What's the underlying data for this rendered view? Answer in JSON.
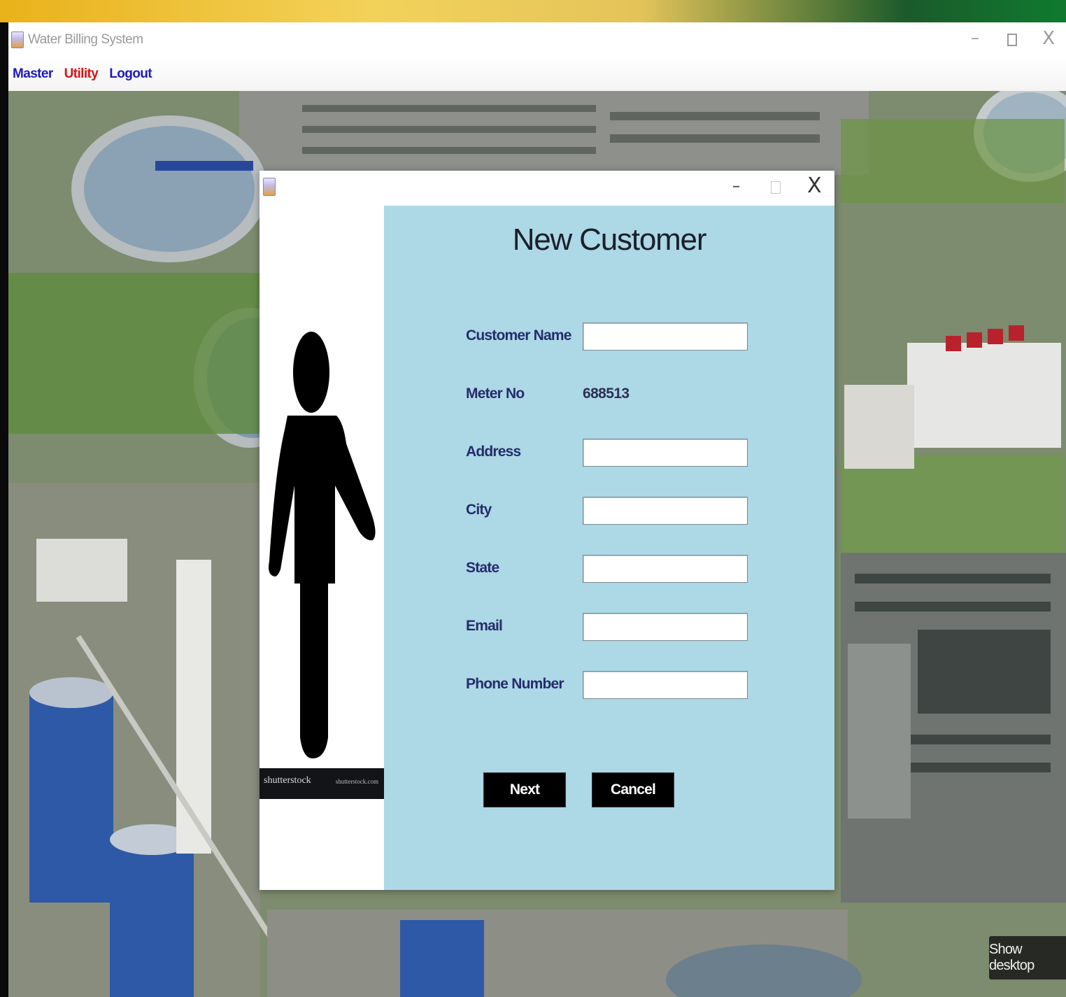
{
  "window": {
    "title": "Water Billing System",
    "controls": {
      "minimize": "–",
      "close": "X"
    }
  },
  "menu": [
    {
      "label": "Master",
      "color": "#1e1ab8"
    },
    {
      "label": "Utility",
      "color": "#d41414"
    },
    {
      "label": "Logout",
      "color": "#1e1ab8"
    }
  ],
  "dialog": {
    "controls": {
      "minimize": "–",
      "close": "X"
    },
    "image": {
      "icon": "person-silhouette-icon",
      "watermark_left": "shutterstock",
      "watermark_right": "shutterstock.com"
    },
    "title": "New Customer",
    "fields": {
      "customer_name": {
        "label": "Customer Name",
        "value": ""
      },
      "meter_no": {
        "label": "Meter No",
        "value": "688513"
      },
      "address": {
        "label": "Address",
        "value": ""
      },
      "city": {
        "label": "City",
        "value": ""
      },
      "state": {
        "label": "State",
        "value": ""
      },
      "email": {
        "label": "Email",
        "value": ""
      },
      "phone": {
        "label": "Phone Number",
        "value": ""
      }
    },
    "buttons": {
      "next": "Next",
      "cancel": "Cancel"
    },
    "panel_color": "#add8e6"
  },
  "taskbar": {
    "show_desktop": "Show desktop"
  }
}
